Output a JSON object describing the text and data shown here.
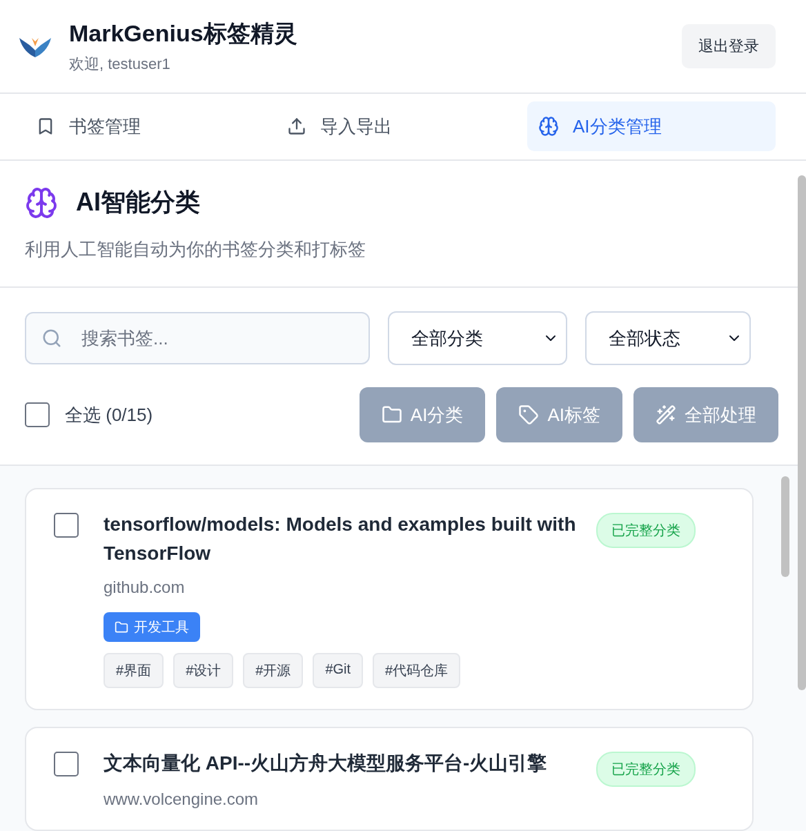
{
  "app": {
    "title": "MarkGenius标签精灵",
    "welcome": "欢迎, testuser1",
    "logout": "退出登录"
  },
  "tabs": [
    {
      "label": "书签管理",
      "kind": "bookmark",
      "selected": false
    },
    {
      "label": "导入导出",
      "kind": "upload",
      "selected": false
    },
    {
      "label": "AI分类管理",
      "kind": "brain",
      "selected": true
    }
  ],
  "section": {
    "title": "AI智能分类",
    "subtitle": "利用人工智能自动为你的书签分类和打标签"
  },
  "search": {
    "placeholder": "搜索书签..."
  },
  "filters": [
    {
      "value": "全部分类"
    },
    {
      "value": "全部状态"
    }
  ],
  "select_all": {
    "label": "全选 (0/15)",
    "checked": false
  },
  "actions": [
    {
      "label": "AI分类",
      "kind": "folder",
      "disabled": true
    },
    {
      "label": "AI标签",
      "kind": "tag",
      "disabled": true
    },
    {
      "label": "全部处理",
      "kind": "wand",
      "disabled": true
    }
  ],
  "bookmarks": [
    {
      "title": "tensorflow/models: Models and examples built with TensorFlow",
      "domain": "github.com",
      "checked": false,
      "status": "已完整分类",
      "category": "开发工具",
      "tags": [
        "#界面",
        "#设计",
        "#开源",
        "#Git",
        "#代码仓库"
      ]
    },
    {
      "title": "文本向量化 API--火山方舟大模型服务平台-火山引擎",
      "domain": "www.volcengine.com",
      "checked": false,
      "status": "已完整分类"
    }
  ]
}
